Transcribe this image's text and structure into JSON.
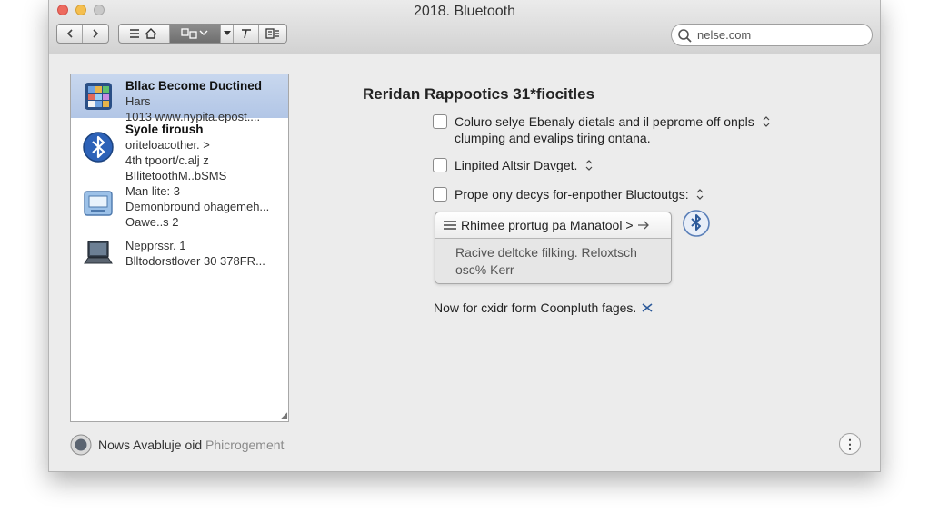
{
  "window": {
    "title": "2018. Bluetooth"
  },
  "search": {
    "value": "nelse.com"
  },
  "sidebar": {
    "items": [
      {
        "line1": "Bllac Become Ductined",
        "line2": "Hars",
        "line3": "1013 www.nypita.epost....",
        "icon": "app-grid-icon",
        "selected": true
      },
      {
        "line1": "Syole firoush",
        "line2": "oriteloacother. >",
        "line3": "4th tpoort/c.alj z",
        "line4": "BIlitetoothM..bSMS",
        "icon": "bluetooth-icon",
        "selected": false
      },
      {
        "line1": "Man lite: 3",
        "line2": "Demonbround ohagemeh...",
        "line3": "Oawe..s 2",
        "icon": "network-drive-icon",
        "selected": false
      },
      {
        "line1": "Nepprssr. 1",
        "line2": "Blltodorstlover 30 378FR...",
        "icon": "laptop-icon",
        "selected": false
      }
    ]
  },
  "main": {
    "heading": "Reridan Rappootics 31*fiocitles",
    "options": [
      {
        "line1": "Coluro selye Ebenaly dietals and il peprome off onpls",
        "line2": "clumping and evalips tiring ontana.",
        "checked": false
      },
      {
        "line1": "Linpited Altsir Davget.",
        "checked": false
      },
      {
        "line1": "Prope ony decys for-enpother Bluctoutgs:",
        "checked": false
      }
    ],
    "dropdown": {
      "selected": "Rhimee prortug pa Manatool >",
      "body_line1": "Racive deltcke filking. Reloxtsch",
      "body_line2": "osc% Kerr"
    },
    "footer_text": "Now for cxidr form Coonpluth fages."
  },
  "status": {
    "text_dark": "Nows Avabluje oid",
    "text_dim": "Phicrogement"
  },
  "colors": {
    "selection": "#b8cbe8",
    "window_bg": "#ececec",
    "accent_blue": "#2d62b8"
  }
}
